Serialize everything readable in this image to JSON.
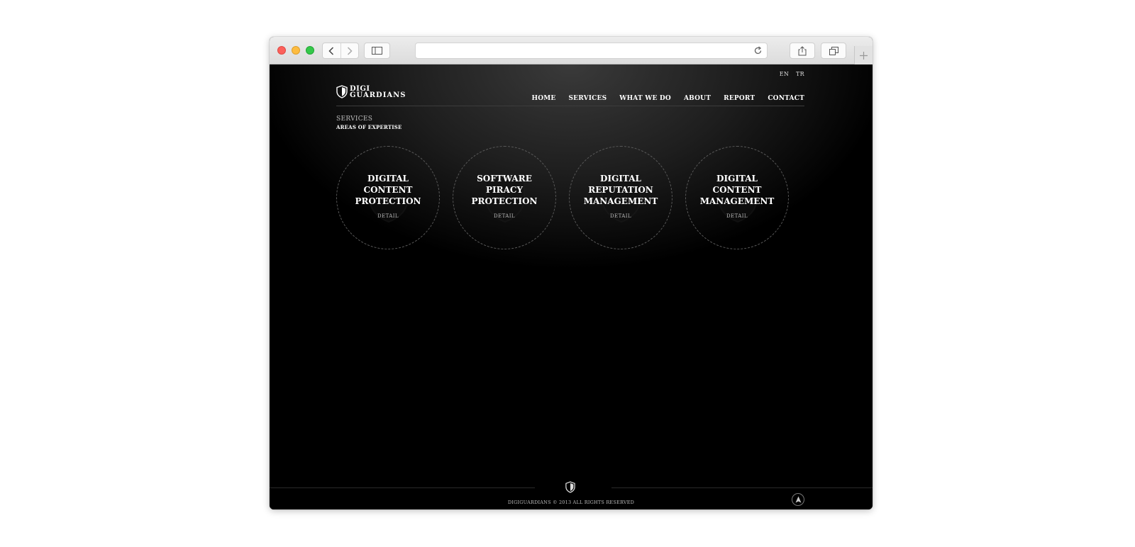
{
  "browser": {
    "address": ""
  },
  "lang": [
    "EN",
    "TR"
  ],
  "logo": {
    "line1": "DIGI",
    "line2": "GUARDIANS"
  },
  "nav": [
    "HOME",
    "SERVICES",
    "WHAT WE DO",
    "ABOUT",
    "REPORT",
    "CONTACT"
  ],
  "breadcrumb": {
    "title": "SERVICES",
    "subtitle": "AREAS OF EXPERTISE"
  },
  "services": [
    {
      "title": "DIGITAL CONTENT PROTECTION",
      "detail": "DETAIL"
    },
    {
      "title": "SOFTWARE PIRACY PROTECTION",
      "detail": "DETAIL"
    },
    {
      "title": "DIGITAL REPUTATION MANAGEMENT",
      "detail": "DETAIL"
    },
    {
      "title": "DIGITAL CONTENT MANAGEMENT",
      "detail": "DETAIL"
    }
  ],
  "footer": {
    "copyright": "DIGIGUARDIANS © 2013 ALL RIGHTS RESERVED"
  },
  "icons": {
    "logo": "shield-icon",
    "footer": "shield-icon",
    "scroll_top": "arrow-up-icon"
  }
}
